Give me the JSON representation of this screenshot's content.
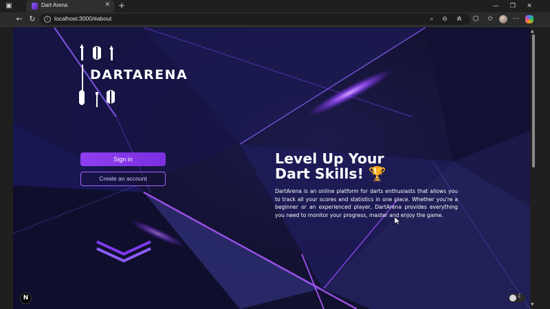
{
  "browser": {
    "tab_title": "Dart Arena",
    "tab_close": "✕",
    "new_tab": "+",
    "url": "localhost:3000/#about",
    "info_glyph": "i",
    "icons": {
      "window": "window-icon",
      "back": "back-arrow-icon",
      "reload": "reload-icon",
      "zoom": "zoom-icon",
      "tracking": "tracking-prevention-icon",
      "read_aloud": "read-aloud-icon",
      "favorite": "star-icon",
      "extensions": "extensions-icon",
      "favorites": "favorites-icon",
      "profile": "profile-avatar",
      "menu": "more-menu-icon",
      "copilot": "copilot-icon"
    }
  },
  "page": {
    "logo_text": "DARTARENA",
    "signin_label": "Sign in",
    "create_account_label": "Create an account",
    "hero_title_line1": "Level Up Your",
    "hero_title_line2": "Dart Skills!",
    "trophy_emoji": "🏆",
    "hero_description": "DartArena is an online platform for darts enthusiasts that allows you to track all your scores and statistics in one place. Whether you're a beginner or an experienced player, DartArena provides everything you need to monitor your progress, master and enjoy the game.",
    "next_badge": "N",
    "colors": {
      "accent": "#8e3ff0",
      "background": "#141335",
      "glow": "#a855f7"
    }
  }
}
